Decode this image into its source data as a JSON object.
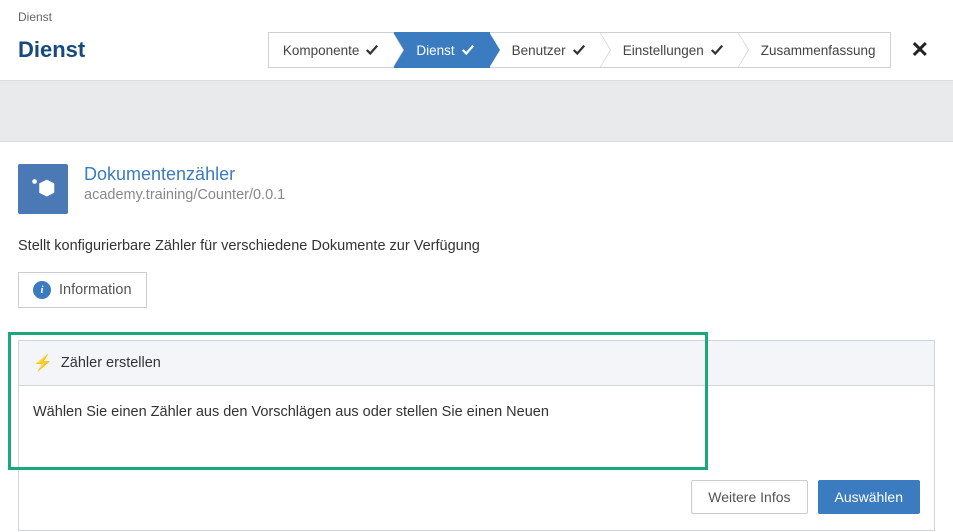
{
  "breadcrumb": "Dienst",
  "page_title": "Dienst",
  "wizard": {
    "steps": [
      {
        "label": "Komponente",
        "active": false,
        "checked": true
      },
      {
        "label": "Dienst",
        "active": true,
        "checked": true
      },
      {
        "label": "Benutzer",
        "active": false,
        "checked": true
      },
      {
        "label": "Einstellungen",
        "active": false,
        "checked": true
      },
      {
        "label": "Zusammenfassung",
        "active": false,
        "checked": false
      }
    ]
  },
  "close_label": "✕",
  "module": {
    "title": "Dokumentenzähler",
    "path": "academy.training/Counter/0.0.1",
    "description": "Stellt konfigurierbare Zähler für verschiedene Dokumente zur Verfügung"
  },
  "info_button_label": "Information",
  "action": {
    "header": "Zähler erstellen",
    "body": "Wählen Sie einen Zähler aus den Vorschlägen aus oder stellen Sie einen Neuen",
    "more_label": "Weitere Infos",
    "select_label": "Auswählen"
  }
}
